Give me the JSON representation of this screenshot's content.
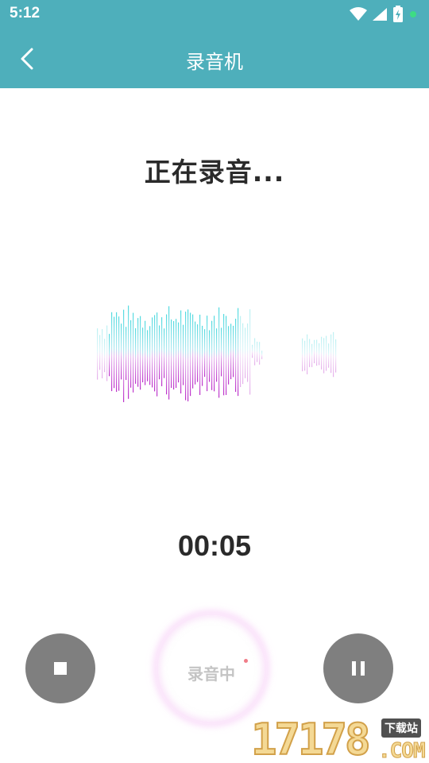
{
  "status_bar": {
    "time": "5:12",
    "icons": [
      "wifi-icon",
      "cell-signal-icon",
      "battery-charging-icon",
      "notification-dot-icon"
    ]
  },
  "app_bar": {
    "title": "录音机",
    "back_icon": "chevron-left-icon"
  },
  "recording": {
    "status_text": "正在录音...",
    "elapsed": "00:05"
  },
  "controls": {
    "stop_icon": "stop-icon",
    "record_label": "录音中",
    "pause_icon": "pause-icon"
  },
  "watermark": {
    "digits": "17178",
    "tag": "下载站",
    "suffix": ".COM"
  },
  "colors": {
    "accent": "#4eafbb",
    "waveform_top": "#3fd6dc",
    "waveform_bottom": "#b418c4",
    "button_gray": "#7f7f7f",
    "text_dark": "#2a2a2a"
  }
}
